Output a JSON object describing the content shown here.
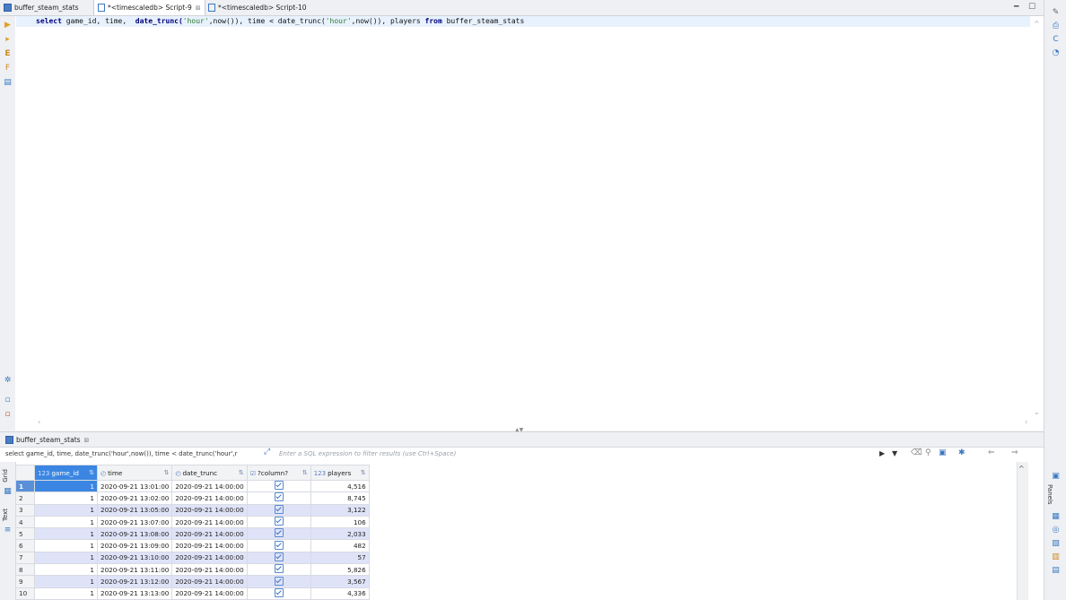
{
  "tabs": [
    {
      "label": "buffer_steam_stats",
      "active": false
    },
    {
      "label": "*<timescaledb> Script-9",
      "active": true,
      "close": "⊠"
    },
    {
      "label": "*<timescaledb> Script-10",
      "active": false
    }
  ],
  "editor": {
    "sql": {
      "p1": "select",
      "p2": " game_id, time,  ",
      "p3": "date_trunc(",
      "p4": "'hour'",
      "p5": ",now()), time < date_trunc(",
      "p6": "'hour'",
      "p7": ",now()), players ",
      "p8": "from",
      "p9": " buffer_steam_stats"
    }
  },
  "results": {
    "tab_label": "buffer_steam_stats",
    "tab_close": "⊠",
    "filter_query": "select game_id, time, date_trunc('hour',now()), time < date_trunc('hour',r",
    "filter_placeholder": "Enter a SQL expression to filter results (use Ctrl+Space)",
    "side_tabs": {
      "grid": "Grid",
      "text": "Text"
    },
    "panels_label": "Panels",
    "columns": [
      {
        "type": "123",
        "name": "game_id"
      },
      {
        "type": "clock",
        "name": "time"
      },
      {
        "type": "clock",
        "name": "date_trunc"
      },
      {
        "type": "check",
        "name": "?column?"
      },
      {
        "type": "123",
        "name": "players"
      }
    ],
    "rows": [
      {
        "n": "1",
        "game_id": "1",
        "time": "2020-09-21 13:01:00",
        "date_trunc": "2020-09-21 14:00:00",
        "players": "4,516"
      },
      {
        "n": "2",
        "game_id": "1",
        "time": "2020-09-21 13:02:00",
        "date_trunc": "2020-09-21 14:00:00",
        "players": "8,745"
      },
      {
        "n": "3",
        "game_id": "1",
        "time": "2020-09-21 13:05:00",
        "date_trunc": "2020-09-21 14:00:00",
        "players": "3,122"
      },
      {
        "n": "4",
        "game_id": "1",
        "time": "2020-09-21 13:07:00",
        "date_trunc": "2020-09-21 14:00:00",
        "players": "106"
      },
      {
        "n": "5",
        "game_id": "1",
        "time": "2020-09-21 13:08:00",
        "date_trunc": "2020-09-21 14:00:00",
        "players": "2,033"
      },
      {
        "n": "6",
        "game_id": "1",
        "time": "2020-09-21 13:09:00",
        "date_trunc": "2020-09-21 14:00:00",
        "players": "482"
      },
      {
        "n": "7",
        "game_id": "1",
        "time": "2020-09-21 13:10:00",
        "date_trunc": "2020-09-21 14:00:00",
        "players": "57"
      },
      {
        "n": "8",
        "game_id": "1",
        "time": "2020-09-21 13:11:00",
        "date_trunc": "2020-09-21 14:00:00",
        "players": "5,826"
      },
      {
        "n": "9",
        "game_id": "1",
        "time": "2020-09-21 13:12:00",
        "date_trunc": "2020-09-21 14:00:00",
        "players": "3,567"
      },
      {
        "n": "10",
        "game_id": "1",
        "time": "2020-09-21 13:13:00",
        "date_trunc": "2020-09-21 14:00:00",
        "players": "4,336"
      }
    ]
  }
}
